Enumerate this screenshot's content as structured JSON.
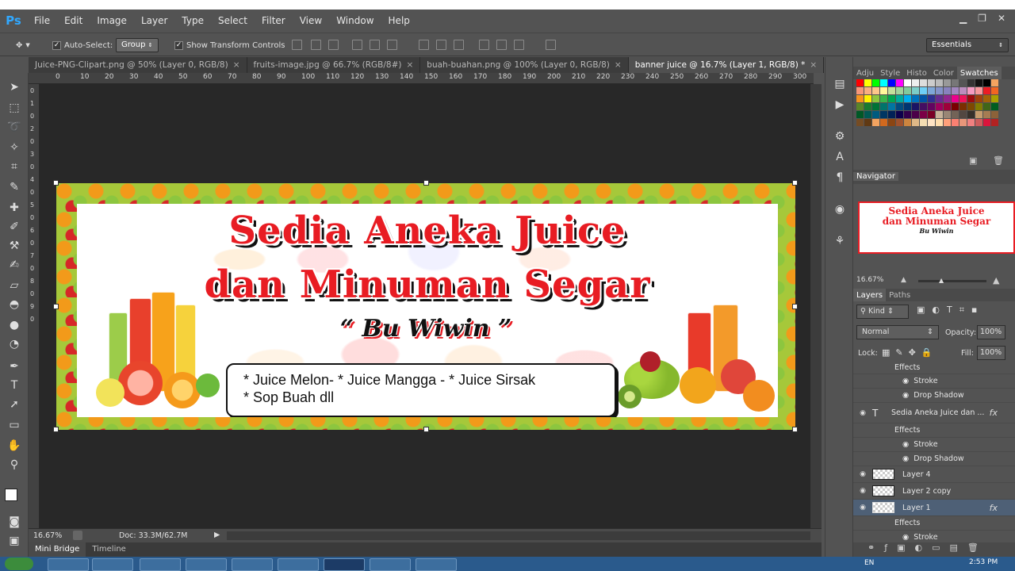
{
  "app": {
    "logo": "Ps"
  },
  "menu": [
    "File",
    "Edit",
    "Image",
    "Layer",
    "Type",
    "Select",
    "Filter",
    "View",
    "Window",
    "Help"
  ],
  "options": {
    "auto_select_label": "Auto-Select:",
    "auto_select_value": "Group",
    "show_transform_label": "Show Transform Controls",
    "workspace": "Essentials"
  },
  "tabs": [
    {
      "label": "Juice-PNG-Clipart.png @ 50% (Layer 0, RGB/8)",
      "active": false
    },
    {
      "label": "fruits-image.jpg @ 66.7% (RGB/8#)",
      "active": false
    },
    {
      "label": "buah-buahan.png @ 100% (Layer 0, RGB/8)",
      "active": false
    },
    {
      "label": "banner juice @ 16.7% (Layer 1, RGB/8) *",
      "active": true
    }
  ],
  "ruler_top": [
    "0",
    "10",
    "20",
    "30",
    "40",
    "50",
    "60",
    "70",
    "80",
    "90",
    "100",
    "110",
    "120",
    "130",
    "140",
    "150",
    "160",
    "170",
    "180",
    "190",
    "200",
    "210",
    "220",
    "230",
    "240",
    "250",
    "260",
    "270",
    "280",
    "290",
    "300"
  ],
  "ruler_left": [
    "0",
    "1",
    "0",
    "2",
    "0",
    "3",
    "0",
    "4",
    "0",
    "5",
    "0",
    "6",
    "0",
    "7",
    "0",
    "8",
    "0",
    "9",
    "0"
  ],
  "banner": {
    "title_line1": "Sedia Aneka Juice",
    "title_line2": "dan Minuman Segar",
    "owner": "“ Bu Wiwin ”",
    "menu_line1": "* Juice Melon- * Juice Mangga - * Juice Sirsak",
    "menu_line2": "* Sop Buah dll"
  },
  "status": {
    "zoom": "16.67%",
    "doc": "Doc: 33.3M/62.7M"
  },
  "bottom_tabs": [
    "Mini Bridge",
    "Timeline"
  ],
  "panels": {
    "top_tabs": [
      "Adju",
      "Style",
      "Histo",
      "Color",
      "Swatches"
    ],
    "navigator_title": "Navigator",
    "navigator_zoom": "16.67%",
    "navigator_preview_line1": "Sedia Aneka Juice",
    "navigator_preview_line2": "dan Minuman Segar",
    "navigator_preview_owner": "Bu Wiwin",
    "layers_tabs": [
      "Layers",
      "Paths"
    ],
    "kind_label": "Kind",
    "blend_mode": "Normal",
    "opacity_label": "Opacity:",
    "opacity_value": "100%",
    "lock_label": "Lock:",
    "fill_label": "Fill:",
    "fill_value": "100%",
    "effects_label": "Effects",
    "stroke_label": "Stroke",
    "drop_shadow_label": "Drop Shadow",
    "text_layer_label": "Sedia Aneka Juice dan ...",
    "layer4": "Layer 4",
    "layer2copy": "Layer 2 copy",
    "layer1": "Layer 1",
    "fx_label": "fx"
  },
  "taskbar": {
    "lang": "EN",
    "clock": "2:53 PM"
  },
  "colors": {
    "title_red": "#e81c23",
    "ps_blue": "#31a8ff",
    "selected_layer": "#4e6076"
  }
}
